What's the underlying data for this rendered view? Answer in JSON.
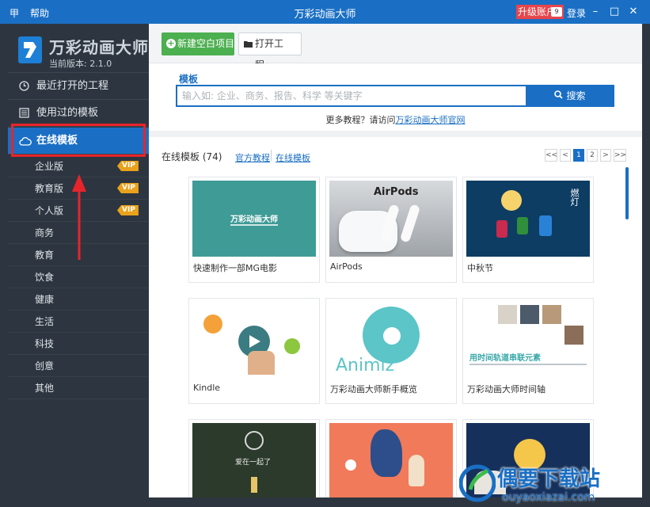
{
  "titlebar": {
    "menu_icon": "甲",
    "help": "帮助",
    "title": "万彩动画大师",
    "upgrade": "升级账户",
    "user_badge": "9",
    "login": "登录",
    "minimize": "–",
    "maximize": "□",
    "close": "✕"
  },
  "sidebar": {
    "brand": "万彩动画大师",
    "version": "当前版本: 2.1.0",
    "nav": [
      {
        "label": "最近打开的工程",
        "icon": "clock-icon"
      },
      {
        "label": "使用过的模板",
        "icon": "template-icon"
      },
      {
        "label": "在线模板",
        "icon": "cloud-icon"
      }
    ],
    "sub_items": [
      {
        "label": "企业版",
        "vip": "VIP"
      },
      {
        "label": "教育版",
        "vip": "VIP"
      },
      {
        "label": "个人版",
        "vip": "VIP"
      },
      {
        "label": "商务",
        "vip": ""
      },
      {
        "label": "教育",
        "vip": ""
      },
      {
        "label": "饮食",
        "vip": ""
      },
      {
        "label": "健康",
        "vip": ""
      },
      {
        "label": "生活",
        "vip": ""
      },
      {
        "label": "科技",
        "vip": ""
      },
      {
        "label": "创意",
        "vip": ""
      },
      {
        "label": "其他",
        "vip": ""
      }
    ]
  },
  "toolbar": {
    "new_blank": "新建空白项目",
    "open_project": "打开工程..."
  },
  "search": {
    "label": "模板",
    "placeholder": "输入如: 企业、商务、报告、科学 等关键字",
    "button": "搜索",
    "more_prefix": "更多教程？请访问",
    "more_link": "万彩动画大师官网"
  },
  "gallery": {
    "header": "在线模板 (74)",
    "tab_official": "官方教程",
    "tab_online": "在线模板",
    "pager": [
      "<<",
      "<",
      "1",
      "2",
      ">",
      ">>"
    ],
    "cards": [
      {
        "label": "快速制作一部MG电影",
        "thumb_text": "万彩动画大师"
      },
      {
        "label": "AirPods",
        "thumb_text": "AirPods"
      },
      {
        "label": "中秋节",
        "thumb_text": "燃灯"
      },
      {
        "label": "Kindle",
        "thumb_text": ""
      },
      {
        "label": "万彩动画大师新手概览",
        "thumb_text": "Animiz"
      },
      {
        "label": "万彩动画大师时间轴",
        "thumb_text": "用时间轨道串联元素"
      },
      {
        "label": "",
        "thumb_text": "爱在一起了"
      },
      {
        "label": "",
        "thumb_text": ""
      },
      {
        "label": "",
        "thumb_text": ""
      }
    ]
  },
  "watermark": {
    "main": "偶要下载站",
    "sub": "ouyaoxiazai.com"
  },
  "colors": {
    "accent": "#1a6fc4",
    "sidebar_bg": "#2d3640",
    "green": "#4caf50",
    "vip": "#e8a21c",
    "highlight": "#e8242b"
  }
}
